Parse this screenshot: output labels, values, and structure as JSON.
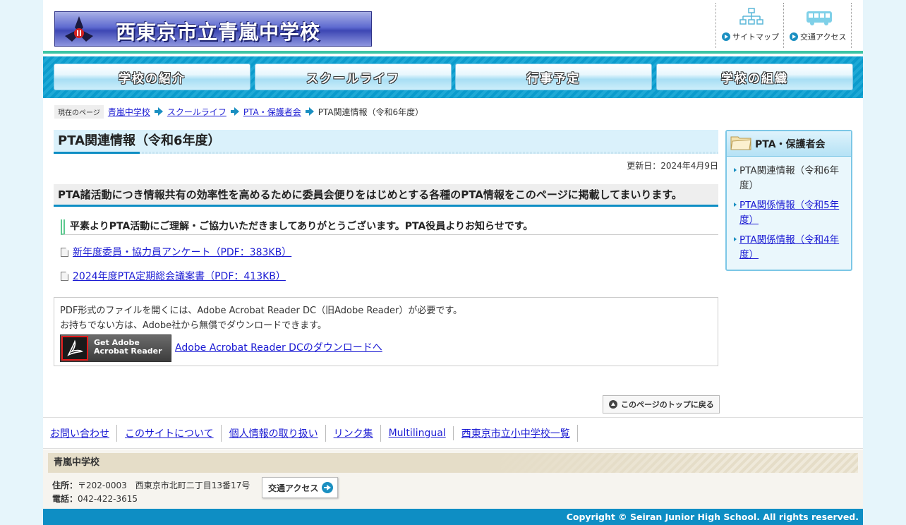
{
  "header": {
    "logo_text": "西東京市立青嵐中学校",
    "util": [
      {
        "label": "サイトマップ",
        "icon": "sitemap-icon"
      },
      {
        "label": "交通アクセス",
        "icon": "bus-icon"
      }
    ]
  },
  "gnav": [
    "学校の紹介",
    "スクールライフ",
    "行事予定",
    "学校の組織"
  ],
  "breadcrumb": {
    "label": "現在のページ",
    "links": [
      "青嵐中学校",
      "スクールライフ",
      "PTA・保護者会"
    ],
    "current": "PTA関連情報（令和6年度）"
  },
  "main": {
    "title": "PTA関連情報（令和6年度）",
    "updated": "更新日：2024年4月9日",
    "h2": "PTA諸活動につき情報共有の効率性を高めるために委員会便りをはじめとする各種のPTA情報をこのページに掲載してまいります。",
    "h3": "平素よりPTA活動にご理解・ご協力いただきましてありがとうございます。PTA役員よりお知らせです。",
    "files": [
      "新年度委員・協力員アンケート（PDF：383KB）",
      "2024年度PTA定期総会議案書（PDF：413KB）"
    ],
    "pdf_note_1": "PDF形式のファイルを開くには、Adobe Acrobat Reader DC（旧Adobe Reader）が必要です。",
    "pdf_note_2": "お持ちでない方は、Adobe社から無償でダウンロードできます。",
    "adobe_badge_1": "Get Adobe",
    "adobe_badge_2": "Acrobat Reader",
    "adobe_link": "Adobe Acrobat Reader DCのダウンロードへ",
    "pagetop": "このページのトップに戻る"
  },
  "side": {
    "title": "PTA・保護者会",
    "current": "PTA関連情報（令和6年度）",
    "links": [
      "PTA関係情報（令和5年度）",
      "PTA関係情報（令和4年度）"
    ]
  },
  "footer": {
    "links": [
      "お問い合わせ",
      "このサイトについて",
      "個人情報の取り扱い",
      "リンク集",
      "Multilingual",
      "西東京市立小中学校一覧"
    ],
    "school": "青嵐中学校",
    "addr_label": "住所：",
    "addr": "〒202-0003　西東京市北町二丁目13番17号",
    "tel_label": "電話：",
    "tel": "042-422-3615",
    "access_btn": "交通アクセス",
    "copyright": "Copyright © Seiran Junior High School. All rights reserved."
  },
  "colors": {
    "accent_blue": "#0e8ec4",
    "header_green": "#3cc4a4",
    "link": "#1b1bd3"
  }
}
